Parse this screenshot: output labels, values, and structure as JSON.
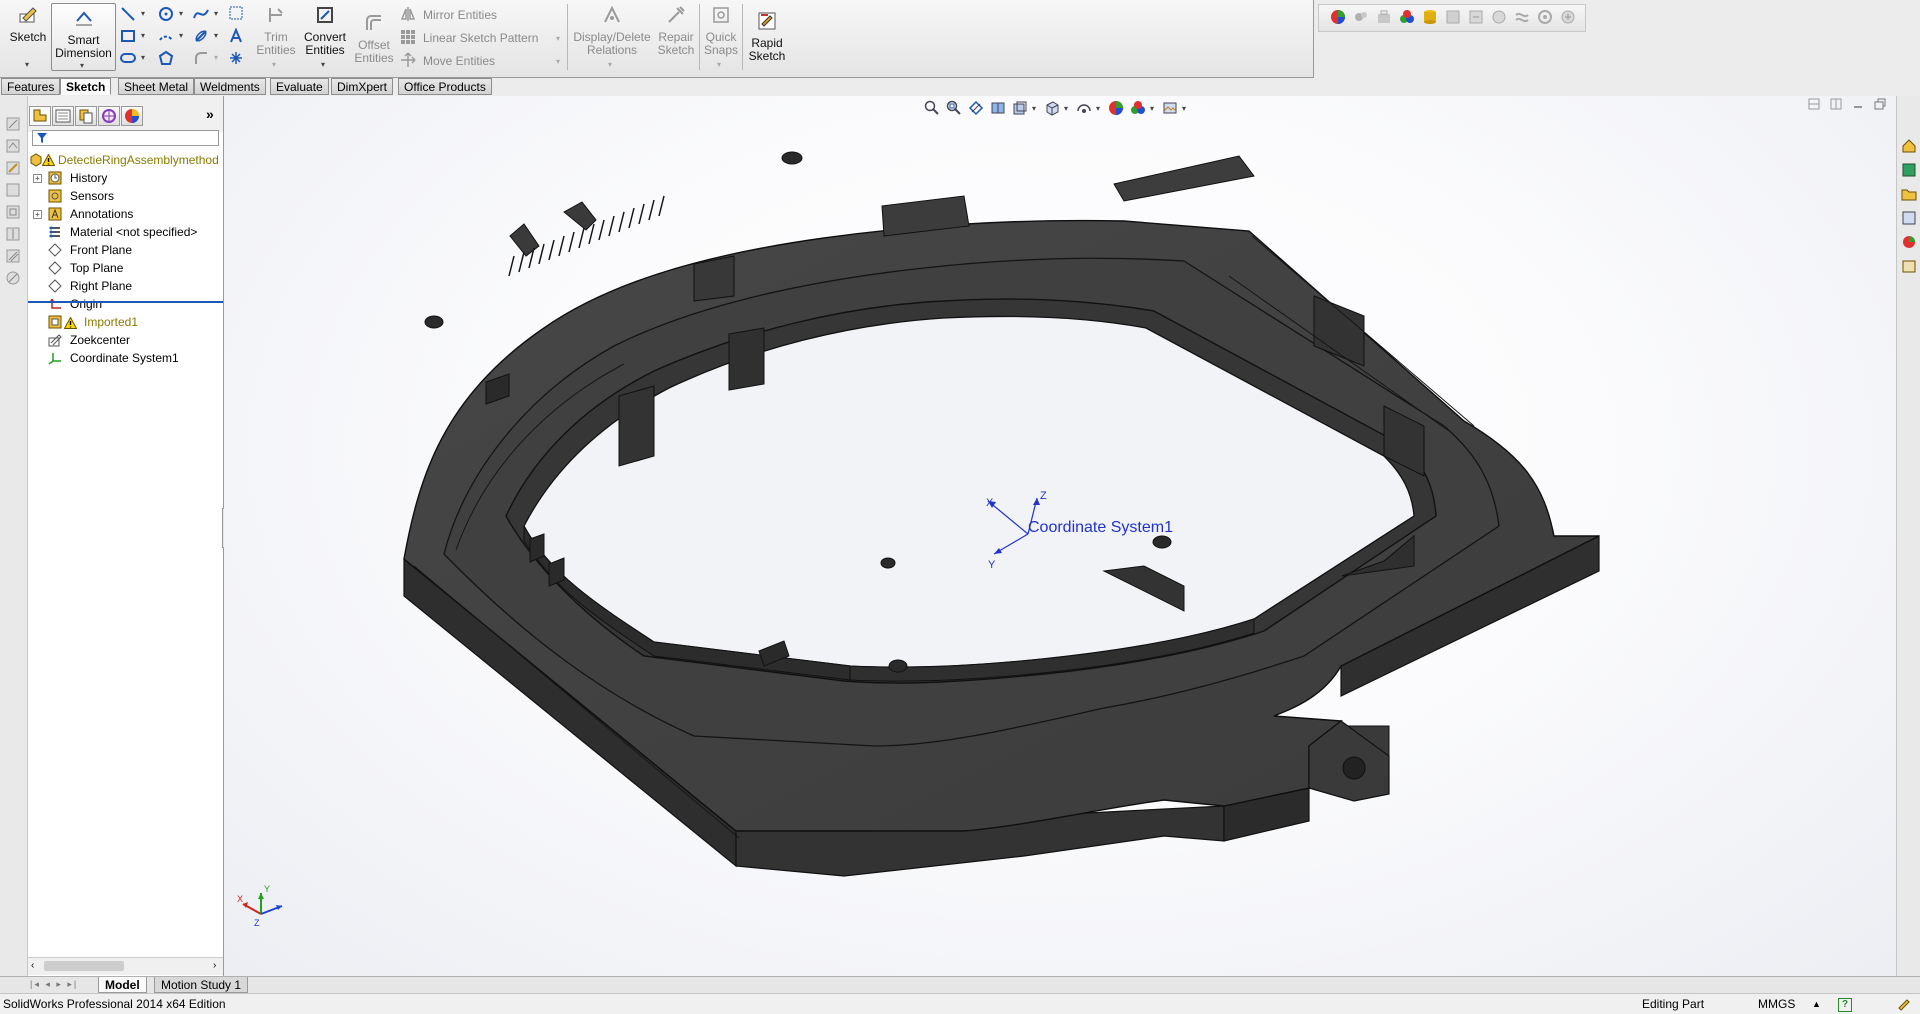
{
  "ribbon": {
    "sketch": "Sketch",
    "smart_dimension": [
      "Smart",
      "Dimension"
    ],
    "trim_entities": [
      "Trim",
      "Entities"
    ],
    "convert_entities": [
      "Convert",
      "Entities"
    ],
    "offset_entities": [
      "Offset",
      "Entities"
    ],
    "mirror_entities": "Mirror Entities",
    "linear_sketch_pattern": "Linear Sketch Pattern",
    "move_entities": "Move Entities",
    "display_delete_relations": [
      "Display/Delete",
      "Relations"
    ],
    "repair_sketch": [
      "Repair",
      "Sketch"
    ],
    "quick_snaps": [
      "Quick",
      "Snaps"
    ],
    "rapid_sketch": [
      "Rapid",
      "Sketch"
    ]
  },
  "command_tabs": [
    "Features",
    "Sketch",
    "Sheet Metal",
    "Weldments",
    "Evaluate",
    "DimXpert",
    "Office Products"
  ],
  "active_command_tab": "Sketch",
  "feature_tree": {
    "root": "DetectieRingAssemblymethod",
    "items": [
      {
        "label": "History",
        "icon": "history-icon",
        "expandable": true
      },
      {
        "label": "Sensors",
        "icon": "sensors-icon",
        "expandable": false
      },
      {
        "label": "Annotations",
        "icon": "annotations-icon",
        "expandable": true
      },
      {
        "label": "Material <not specified>",
        "icon": "material-icon",
        "expandable": false
      },
      {
        "label": "Front Plane",
        "icon": "plane-icon",
        "expandable": false
      },
      {
        "label": "Top Plane",
        "icon": "plane-icon",
        "expandable": false
      },
      {
        "label": "Right Plane",
        "icon": "plane-icon",
        "expandable": false
      },
      {
        "label": "Origin",
        "icon": "origin-icon",
        "expandable": false
      },
      {
        "label": "Imported1",
        "icon": "imported-feature-icon",
        "expandable": false,
        "warning": true
      },
      {
        "label": "Zoekcenter",
        "icon": "sketch-icon",
        "expandable": false
      },
      {
        "label": "Coordinate System1",
        "icon": "coordinate-system-icon",
        "expandable": false
      }
    ]
  },
  "viewport": {
    "coordinate_system_label": "Coordinate System1",
    "axis_x": "X",
    "axis_y": "Y",
    "axis_z": "Z",
    "triad_x": "X",
    "triad_y": "Y",
    "triad_z": "Z"
  },
  "bottom_tabs": [
    "Model",
    "Motion Study 1"
  ],
  "active_bottom_tab": "Model",
  "status_bar": {
    "app": "SolidWorks Professional 2014 x64 Edition",
    "mode": "Editing Part",
    "units": "MMGS",
    "units_caret": "▲",
    "help": "?"
  },
  "colors": {
    "part": "#3a3a3a",
    "part_edge": "#111111",
    "coordinate_system": "#2233cc",
    "tree_warning_text": "#8a7a00"
  }
}
